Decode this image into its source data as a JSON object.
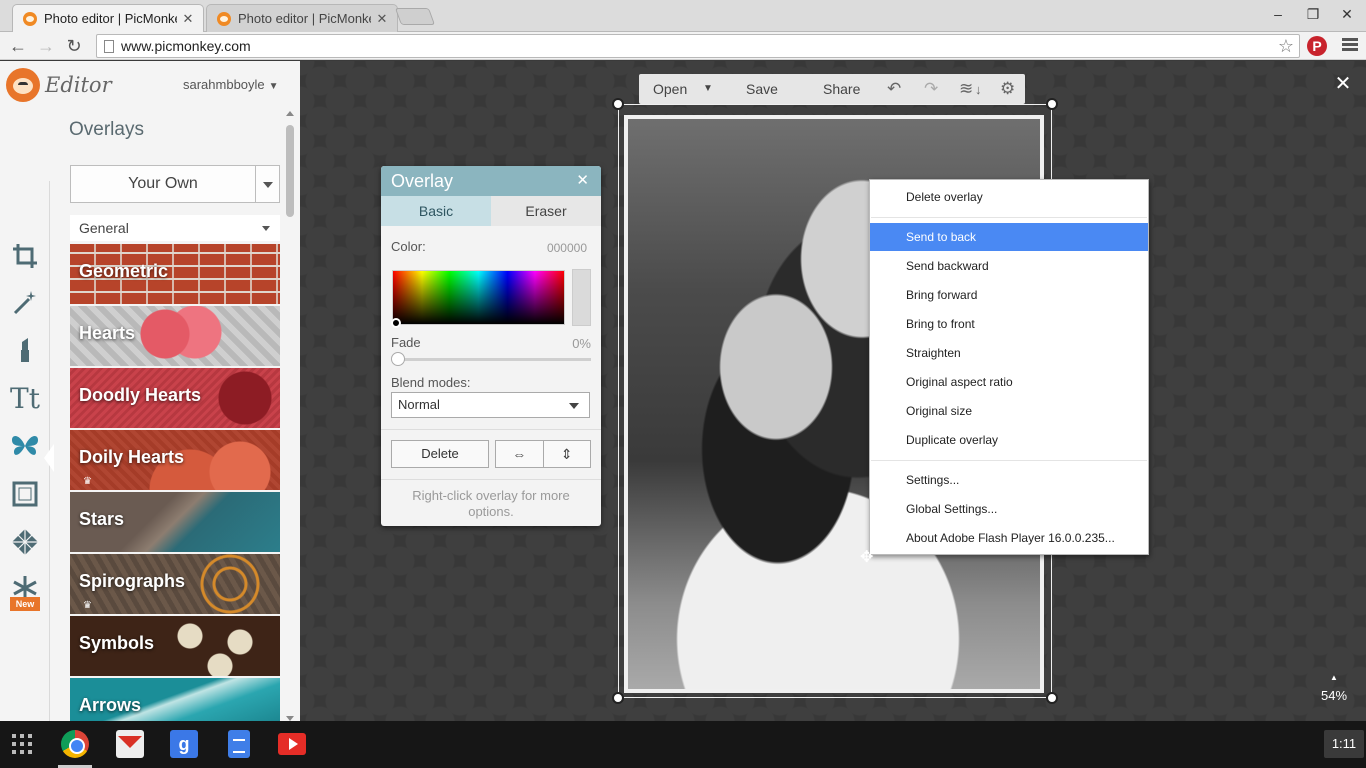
{
  "browser": {
    "tabs": [
      {
        "title": "Photo editor | PicMonkey: ",
        "active": true
      },
      {
        "title": "Photo editor | PicMonkey: ",
        "active": false
      }
    ],
    "url": "www.picmonkey.com"
  },
  "app": {
    "brand": "Editor",
    "username": "sarahmbboyle",
    "rail_new_badge": "New"
  },
  "overlays": {
    "heading": "Overlays",
    "source_button": "Your Own",
    "category_select": "General",
    "categories": [
      {
        "label": "Geometric",
        "premium": false
      },
      {
        "label": "Hearts",
        "premium": false
      },
      {
        "label": "Doodly Hearts",
        "premium": false
      },
      {
        "label": "Doily Hearts",
        "premium": true
      },
      {
        "label": "Stars",
        "premium": false
      },
      {
        "label": "Spirographs",
        "premium": true
      },
      {
        "label": "Symbols",
        "premium": false
      },
      {
        "label": "Arrows",
        "premium": false
      }
    ]
  },
  "canvas_toolbar": {
    "open": "Open",
    "save": "Save",
    "share": "Share"
  },
  "overlay_panel": {
    "title": "Overlay",
    "close": "✕",
    "tabs": [
      "Basic",
      "Eraser"
    ],
    "color_label": "Color:",
    "color_value": "000000",
    "fade_label": "Fade",
    "fade_value": "0%",
    "blend_label": "Blend modes:",
    "blend_value": "Normal",
    "delete": "Delete",
    "hint": "Right-click overlay for more options."
  },
  "context_menu": {
    "items": [
      "Delete overlay",
      "Send to back",
      "Send backward",
      "Bring forward",
      "Bring to front",
      "Straighten",
      "Original aspect ratio",
      "Original size",
      "Duplicate overlay",
      "Settings...",
      "Global Settings...",
      "About Adobe Flash Player 16.0.0.235..."
    ],
    "highlighted": "Send to back"
  },
  "zoom": "54%",
  "taskbar": {
    "clock": "1:11"
  },
  "colors": {
    "accent_panel": "#8bb5bf",
    "menu_highlight": "#4a89f3",
    "brand_orange": "#e8752a"
  }
}
